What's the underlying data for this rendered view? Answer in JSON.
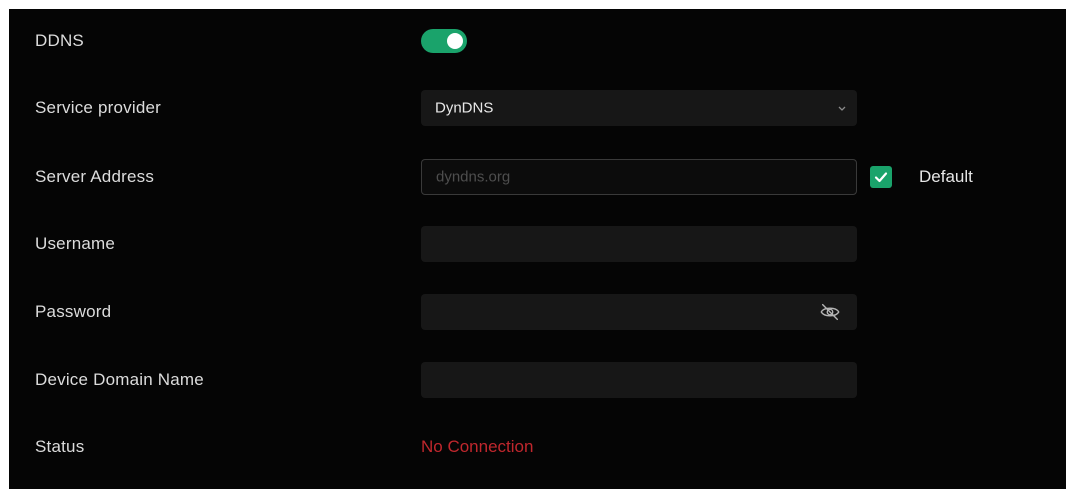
{
  "ddns": {
    "label": "DDNS",
    "enabled": true,
    "accent_color": "#1aa36b"
  },
  "service_provider": {
    "label": "Service provider",
    "value": "DynDNS",
    "icon": "chevron-down-icon"
  },
  "server_address": {
    "label": "Server Address",
    "placeholder": "dyndns.org",
    "default_checked": true,
    "default_label": "Default"
  },
  "username": {
    "label": "Username",
    "value": ""
  },
  "password": {
    "label": "Password",
    "value": "",
    "icon": "eye-off-icon"
  },
  "device_domain_name": {
    "label": "Device Domain Name",
    "value": ""
  },
  "status": {
    "label": "Status",
    "value": "No Connection",
    "color": "#c0272d"
  }
}
